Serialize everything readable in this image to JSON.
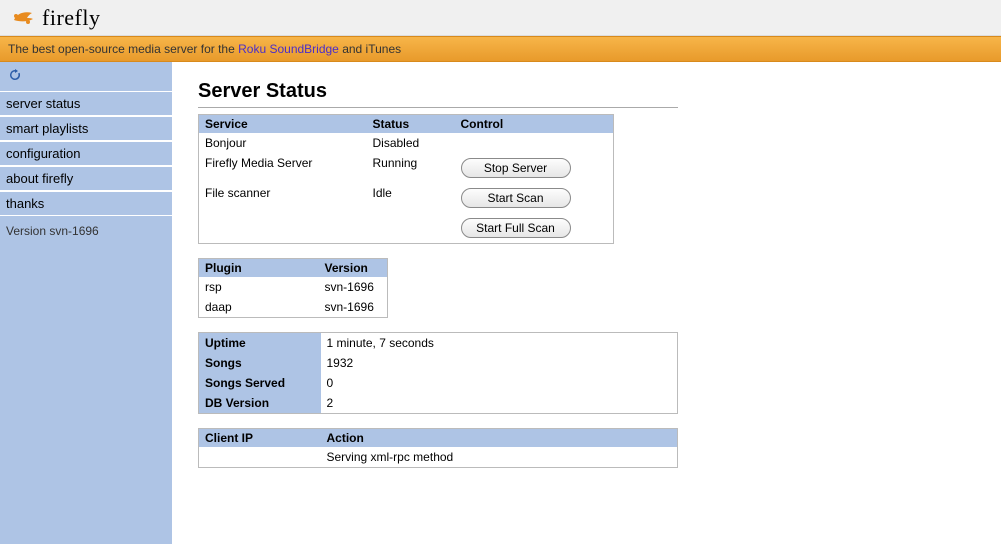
{
  "app_name": "firefly",
  "tagline_pre": "The best open-source media server for the ",
  "tagline_link": "Roku SoundBridge",
  "tagline_post": " and iTunes",
  "sidebar": {
    "items": [
      "server status",
      "smart playlists",
      "configuration",
      "about firefly",
      "thanks"
    ],
    "version": "Version svn-1696"
  },
  "page_title": "Server Status",
  "services": {
    "headers": [
      "Service",
      "Status",
      "Control"
    ],
    "rows": [
      {
        "name": "Bonjour",
        "status": "Disabled"
      },
      {
        "name": "Firefly Media Server",
        "status": "Running"
      },
      {
        "name": "File scanner",
        "status": "Idle"
      }
    ],
    "buttons": {
      "stop_server": "Stop Server",
      "start_scan": "Start Scan",
      "start_full_scan": "Start Full Scan"
    }
  },
  "plugins": {
    "headers": [
      "Plugin",
      "Version"
    ],
    "rows": [
      {
        "name": "rsp",
        "version": "svn-1696"
      },
      {
        "name": "daap",
        "version": "svn-1696"
      }
    ]
  },
  "stats": {
    "rows": [
      {
        "label": "Uptime",
        "value": "1 minute, 7 seconds"
      },
      {
        "label": "Songs",
        "value": "1932"
      },
      {
        "label": "Songs Served",
        "value": "0"
      },
      {
        "label": "DB Version",
        "value": "2"
      }
    ]
  },
  "clients": {
    "headers": [
      "Client IP",
      "Action"
    ],
    "rows": [
      {
        "ip": "",
        "action": "Serving xml-rpc method"
      }
    ]
  }
}
